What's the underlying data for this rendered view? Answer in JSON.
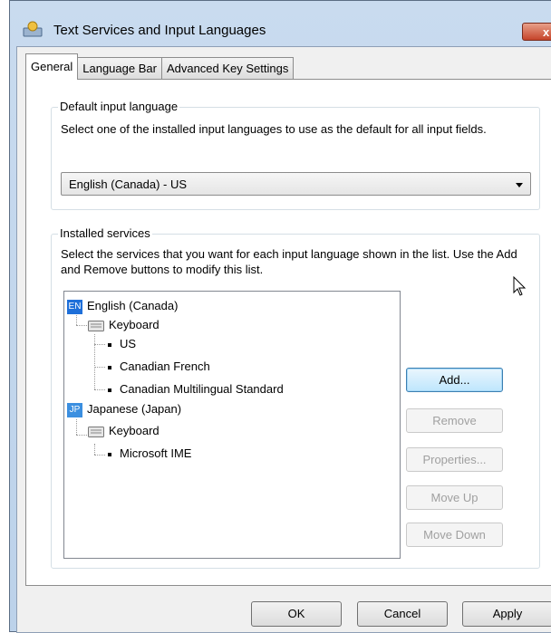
{
  "window": {
    "title": "Text Services and Input Languages",
    "close_label": "x"
  },
  "tabs": [
    {
      "label": "General",
      "active": true
    },
    {
      "label": "Language Bar",
      "active": false
    },
    {
      "label": "Advanced Key Settings",
      "active": false
    }
  ],
  "default_input": {
    "group_label": "Default input language",
    "description": "Select one of the installed input languages to use as the default for all input fields.",
    "selected_value": "English (Canada) - US"
  },
  "installed_services": {
    "group_label": "Installed services",
    "description": "Select the services that you want for each input language shown in the list. Use the Add and Remove buttons to modify this list.",
    "tree": {
      "english": {
        "badge": "EN",
        "badge_color": "#1e6fd9",
        "label": "English (Canada)",
        "keyboard_label": "Keyboard",
        "items": [
          "US",
          "Canadian French",
          "Canadian Multilingual Standard"
        ]
      },
      "japanese": {
        "badge": "JP",
        "badge_color": "#3b8fe0",
        "label": "Japanese (Japan)",
        "keyboard_label": "Keyboard",
        "items": [
          "Microsoft IME"
        ]
      }
    },
    "buttons": {
      "add": "Add...",
      "remove": "Remove",
      "properties": "Properties...",
      "move_up": "Move Up",
      "move_down": "Move Down"
    }
  },
  "footer": {
    "ok": "OK",
    "cancel": "Cancel",
    "apply": "Apply"
  }
}
